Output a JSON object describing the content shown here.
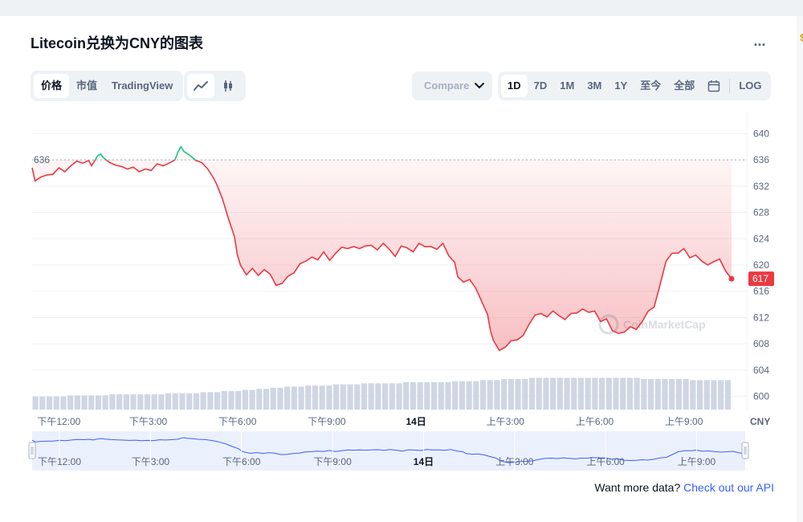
{
  "header": {
    "title": "Litecoin兑换为CNY的图表",
    "more_label": "..."
  },
  "view_tabs": [
    {
      "label": "价格",
      "active": true
    },
    {
      "label": "市值",
      "active": false
    },
    {
      "label": "TradingView",
      "active": false
    }
  ],
  "chart_type_icons": [
    {
      "icon": "line-chart-icon",
      "active": true
    },
    {
      "icon": "candlestick-icon",
      "active": false
    }
  ],
  "compare": {
    "label": "Compare"
  },
  "ranges": {
    "items": [
      {
        "label": "1D",
        "active": true
      },
      {
        "label": "7D",
        "active": false
      },
      {
        "label": "1M",
        "active": false
      },
      {
        "label": "3M",
        "active": false
      },
      {
        "label": "1Y",
        "active": false
      },
      {
        "label": "至今",
        "active": false
      },
      {
        "label": "全部",
        "active": false
      }
    ],
    "calendar_icon": "calendar-icon",
    "log_label": "LOG"
  },
  "chart_data": {
    "type": "line",
    "currency_label": "CNY",
    "open_value": 636,
    "open_label": "636",
    "current_value": 617,
    "current_label": "617",
    "y_ticks": [
      600,
      604,
      608,
      612,
      616,
      620,
      624,
      628,
      632,
      636,
      640
    ],
    "ylim": [
      598,
      642
    ],
    "x_ticks": [
      "下午12:00",
      "下午3:00",
      "下午6:00",
      "下午9:00",
      "14日",
      "上午3:00",
      "上午6:00",
      "上午9:00"
    ],
    "x_tick_bold": [
      "14日"
    ],
    "x_tick_hours": [
      12,
      15,
      18,
      21,
      24,
      27,
      30,
      33
    ],
    "xlim_hours": [
      11.1,
      34.6
    ],
    "grid": true,
    "colors": {
      "up": "#16c784",
      "down": "#ea3943",
      "area_top": "#ea3943",
      "volume": "#cfd6e4",
      "nav_line": "#3861fb",
      "nav_fill": "#dbe3fb",
      "open_line": "#a6b0c3"
    },
    "series": [
      {
        "values": [
          [
            11.1,
            634.8
          ],
          [
            11.2,
            632.8
          ],
          [
            11.4,
            633.4
          ],
          [
            11.6,
            633.7
          ],
          [
            11.8,
            633.8
          ],
          [
            12.0,
            634.8
          ],
          [
            12.2,
            634.2
          ],
          [
            12.4,
            635.1
          ],
          [
            12.6,
            635.8
          ],
          [
            12.8,
            635.5
          ],
          [
            13.0,
            635.9
          ],
          [
            13.1,
            635.1
          ],
          [
            13.3,
            636.6
          ],
          [
            13.4,
            636.9
          ],
          [
            13.5,
            636.3
          ],
          [
            13.7,
            635.6
          ],
          [
            13.9,
            635.2
          ],
          [
            14.1,
            635.0
          ],
          [
            14.3,
            634.6
          ],
          [
            14.5,
            634.9
          ],
          [
            14.7,
            634.2
          ],
          [
            14.9,
            634.6
          ],
          [
            15.1,
            634.4
          ],
          [
            15.3,
            635.4
          ],
          [
            15.5,
            635.1
          ],
          [
            15.7,
            635.5
          ],
          [
            15.9,
            636.0
          ],
          [
            16.0,
            637.2
          ],
          [
            16.1,
            638.0
          ],
          [
            16.2,
            637.3
          ],
          [
            16.4,
            636.7
          ],
          [
            16.6,
            635.9
          ],
          [
            16.8,
            635.6
          ],
          [
            17.0,
            634.6
          ],
          [
            17.2,
            633.2
          ],
          [
            17.3,
            632.3
          ],
          [
            17.5,
            630.0
          ],
          [
            17.7,
            627.0
          ],
          [
            17.9,
            624.3
          ],
          [
            18.0,
            621.5
          ],
          [
            18.1,
            620.0
          ],
          [
            18.3,
            618.5
          ],
          [
            18.5,
            619.5
          ],
          [
            18.7,
            618.4
          ],
          [
            18.9,
            619.3
          ],
          [
            19.1,
            618.6
          ],
          [
            19.3,
            616.9
          ],
          [
            19.5,
            617.2
          ],
          [
            19.7,
            618.3
          ],
          [
            19.9,
            618.8
          ],
          [
            20.1,
            620.2
          ],
          [
            20.3,
            620.6
          ],
          [
            20.5,
            621.2
          ],
          [
            20.7,
            620.8
          ],
          [
            20.9,
            622.0
          ],
          [
            21.1,
            620.7
          ],
          [
            21.3,
            621.8
          ],
          [
            21.5,
            622.7
          ],
          [
            21.7,
            622.5
          ],
          [
            21.9,
            622.8
          ],
          [
            22.1,
            622.5
          ],
          [
            22.3,
            622.9
          ],
          [
            22.5,
            623.0
          ],
          [
            22.7,
            622.3
          ],
          [
            22.9,
            623.3
          ],
          [
            23.1,
            622.4
          ],
          [
            23.3,
            621.3
          ],
          [
            23.5,
            622.9
          ],
          [
            23.7,
            622.6
          ],
          [
            23.9,
            622.0
          ],
          [
            24.1,
            623.3
          ],
          [
            24.3,
            622.8
          ],
          [
            24.5,
            622.8
          ],
          [
            24.7,
            622.4
          ],
          [
            24.9,
            623.3
          ],
          [
            25.1,
            621.4
          ],
          [
            25.3,
            620.4
          ],
          [
            25.4,
            618.2
          ],
          [
            25.6,
            617.4
          ],
          [
            25.8,
            617.8
          ],
          [
            26.0,
            616.5
          ],
          [
            26.2,
            614.5
          ],
          [
            26.4,
            612.5
          ],
          [
            26.5,
            610.0
          ],
          [
            26.6,
            608.5
          ],
          [
            26.8,
            607.0
          ],
          [
            27.0,
            607.5
          ],
          [
            27.2,
            608.5
          ],
          [
            27.4,
            608.6
          ],
          [
            27.6,
            609.3
          ],
          [
            27.8,
            611.0
          ],
          [
            28.0,
            612.4
          ],
          [
            28.2,
            612.6
          ],
          [
            28.4,
            612.1
          ],
          [
            28.6,
            613.0
          ],
          [
            28.8,
            612.3
          ],
          [
            29.0,
            611.7
          ],
          [
            29.2,
            612.6
          ],
          [
            29.4,
            612.7
          ],
          [
            29.6,
            613.3
          ],
          [
            29.8,
            612.8
          ],
          [
            30.0,
            613.0
          ],
          [
            30.2,
            611.4
          ],
          [
            30.4,
            611.8
          ],
          [
            30.6,
            610.0
          ],
          [
            30.8,
            609.6
          ],
          [
            31.0,
            609.8
          ],
          [
            31.2,
            610.6
          ],
          [
            31.4,
            610.2
          ],
          [
            31.6,
            611.4
          ],
          [
            31.8,
            613.0
          ],
          [
            32.0,
            613.6
          ],
          [
            32.2,
            617.0
          ],
          [
            32.4,
            620.6
          ],
          [
            32.6,
            621.8
          ],
          [
            32.8,
            621.8
          ],
          [
            33.0,
            622.5
          ],
          [
            33.2,
            621.1
          ],
          [
            33.4,
            621.5
          ],
          [
            33.6,
            620.6
          ],
          [
            33.8,
            620.0
          ],
          [
            34.0,
            620.5
          ],
          [
            34.2,
            620.9
          ],
          [
            34.4,
            619.1
          ],
          [
            34.6,
            617.9
          ]
        ]
      }
    ],
    "volume": [
      0.12,
      0.12,
      0.12,
      0.12,
      0.12,
      0.13,
      0.13,
      0.13,
      0.13,
      0.13,
      0.13,
      0.14,
      0.14,
      0.14,
      0.14,
      0.14,
      0.14,
      0.14,
      0.14,
      0.15,
      0.15,
      0.15,
      0.15,
      0.15,
      0.16,
      0.16,
      0.16,
      0.17,
      0.17,
      0.17,
      0.18,
      0.18,
      0.19,
      0.19,
      0.2,
      0.2,
      0.21,
      0.21,
      0.21,
      0.22,
      0.22,
      0.22,
      0.22,
      0.23,
      0.23,
      0.23,
      0.23,
      0.24,
      0.24,
      0.24,
      0.24,
      0.24,
      0.24,
      0.25,
      0.25,
      0.25,
      0.25,
      0.25,
      0.25,
      0.25,
      0.26,
      0.26,
      0.26,
      0.26,
      0.27,
      0.27,
      0.27,
      0.28,
      0.28,
      0.28,
      0.28,
      0.29,
      0.29,
      0.29,
      0.29,
      0.29,
      0.29,
      0.29,
      0.29,
      0.29,
      0.29,
      0.29,
      0.29,
      0.29,
      0.29,
      0.29,
      0.29,
      0.28,
      0.28,
      0.28,
      0.28,
      0.28,
      0.28,
      0.28,
      0.27,
      0.27,
      0.27,
      0.27,
      0.27,
      0.27
    ],
    "navigator": {
      "x_ticks": [
        "下午12:00",
        "下午3:00",
        "下午6:00",
        "下午9:00",
        "14日",
        "上午3:00",
        "上午6:00",
        "上午9:00"
      ]
    },
    "watermark": "CoinMarketCap"
  },
  "footer": {
    "text": "Want more data?",
    "link": "Check out our API"
  }
}
